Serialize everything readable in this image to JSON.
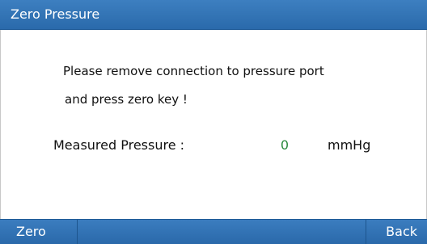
{
  "window": {
    "title": "Zero Pressure"
  },
  "message": {
    "line1": "Please remove connection to pressure port",
    "line2": "and press zero key !"
  },
  "measurement": {
    "label": "Measured Pressure :",
    "value": "0",
    "unit": "mmHg"
  },
  "softkeys": {
    "left_label": "Zero",
    "right_label": "Back"
  },
  "colors": {
    "titlebar": "#2f72b5",
    "footer": "#2f72b5",
    "value_text": "#2b8a3e"
  }
}
